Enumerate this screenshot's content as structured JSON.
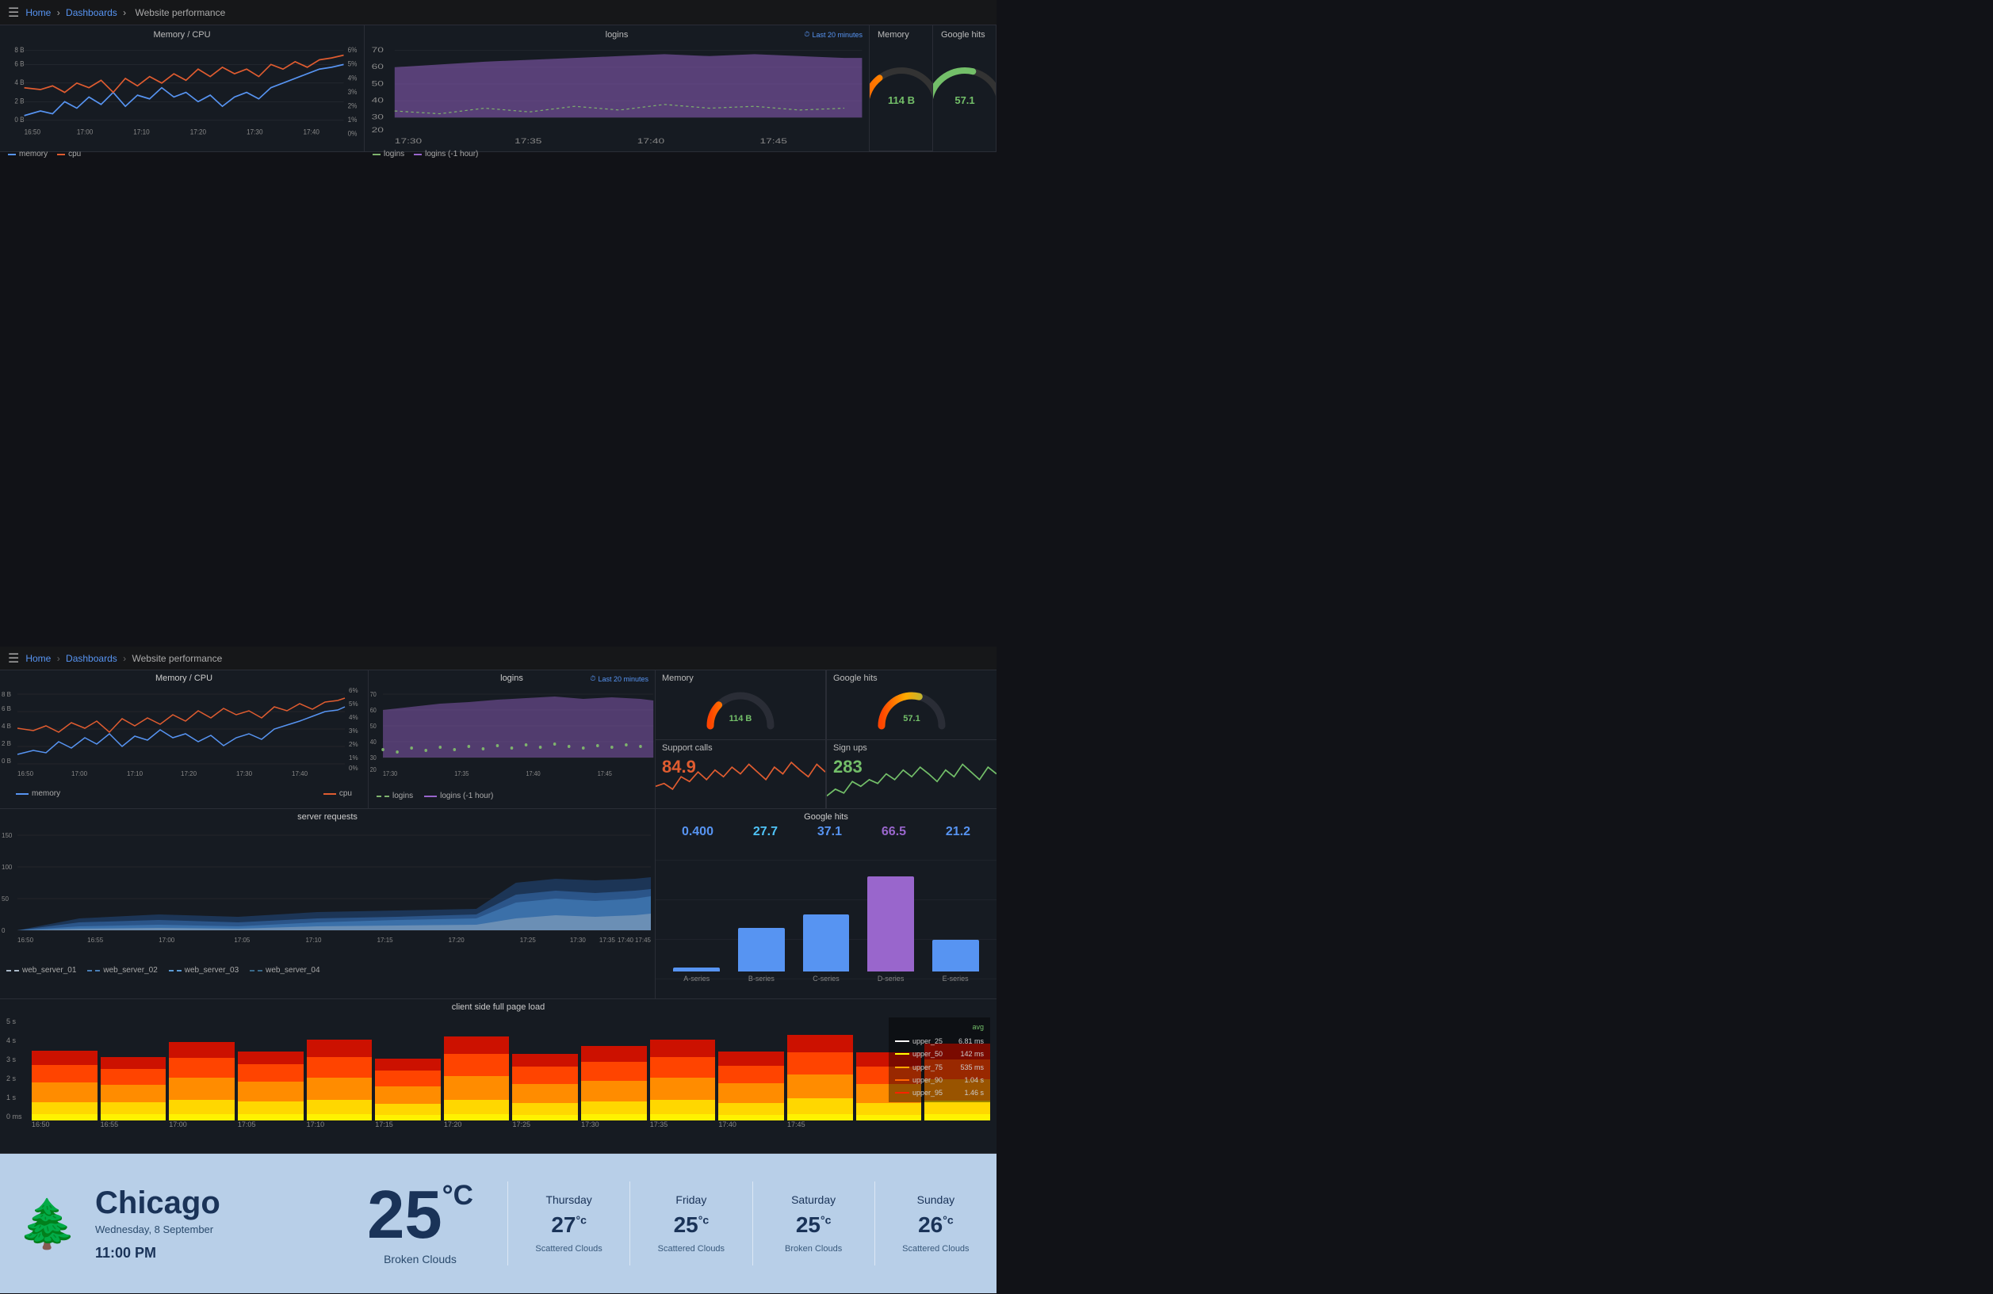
{
  "topbar": {
    "menu_icon": "≡",
    "breadcrumb": [
      {
        "label": "Home",
        "link": true
      },
      {
        "label": "Dashboards",
        "link": true
      },
      {
        "label": "Website performance",
        "link": false
      }
    ]
  },
  "panels": {
    "memory_cpu": {
      "title": "Memory / CPU",
      "legend": [
        {
          "key": "memory",
          "color": "#5794f2",
          "style": "solid"
        },
        {
          "key": "cpu",
          "color": "#e05c30",
          "style": "solid"
        }
      ]
    },
    "logins": {
      "title": "logins",
      "badge": "Last 20 minutes",
      "legend": [
        {
          "key": "logins",
          "color": "#7eb26d"
        },
        {
          "key": "logins (-1 hour)",
          "color": "#9966cc"
        }
      ]
    },
    "memory_stat": {
      "title": "Memory",
      "value": "114 B",
      "value_color": "#73bf69"
    },
    "google_hits_stat": {
      "title": "Google hits",
      "value": "57.1",
      "value_color": "#73bf69"
    },
    "support_calls": {
      "title": "Support calls",
      "value": "84.9",
      "value_color": "#e05c30"
    },
    "sign_ups": {
      "title": "Sign ups",
      "value": "283",
      "value_color": "#73bf69"
    },
    "server_requests": {
      "title": "server requests",
      "legend": [
        {
          "key": "web_server_01",
          "color": "#aaaacc"
        },
        {
          "key": "web_server_02",
          "color": "#4a7eb5"
        },
        {
          "key": "web_server_03",
          "color": "#5b9bd5"
        },
        {
          "key": "web_server_04",
          "color": "#3a6a8a"
        }
      ]
    },
    "google_hits_chart": {
      "title": "Google hits",
      "values": [
        {
          "label": "A-series",
          "value": 0.4,
          "color": "#5794f2",
          "height": 18
        },
        {
          "label": "B-series",
          "value": 27.7,
          "color": "#5794f2",
          "height": 55
        },
        {
          "label": "C-series",
          "value": 37.1,
          "color": "#5794f2",
          "height": 70
        },
        {
          "label": "D-series",
          "value": 66.5,
          "color": "#9966cc",
          "height": 120
        },
        {
          "label": "E-series",
          "value": 21.2,
          "color": "#5794f2",
          "height": 40
        }
      ],
      "value_colors": [
        "#5794f2",
        "#4fc3f7",
        "#5794f2",
        "#9966cc",
        "#5794f2"
      ]
    },
    "client_load": {
      "title": "client side full page load",
      "legend": [
        {
          "key": "upper_25",
          "color": "#fff",
          "avg": "6.81 ms"
        },
        {
          "key": "upper_50",
          "color": "#ffff00",
          "avg": "142 ms"
        },
        {
          "key": "upper_75",
          "color": "#ffa500",
          "avg": "535 ms"
        },
        {
          "key": "upper_90",
          "color": "#ff6600",
          "avg": "1.04 s"
        },
        {
          "key": "upper_95",
          "color": "#ff2200",
          "avg": "1.46 s"
        }
      ],
      "y_labels": [
        "5 s",
        "4 s",
        "3 s",
        "2 s",
        "1 s",
        "0 ms"
      ],
      "x_labels": [
        "16:50",
        "16:55",
        "17:00",
        "17:05",
        "17:10",
        "17:15",
        "17:20",
        "17:25",
        "17:30",
        "17:35",
        "17:40",
        "17:45"
      ]
    }
  },
  "weather": {
    "city": "Chicago",
    "date": "Wednesday, 8 September",
    "time": "11:00 PM",
    "temp": "25",
    "unit": "°C",
    "description": "Broken Clouds",
    "forecasts": [
      {
        "day": "Thursday",
        "temp": "27",
        "unit": "°c",
        "desc": "Scattered Clouds"
      },
      {
        "day": "Friday",
        "temp": "25",
        "unit": "°c",
        "desc": "Scattered Clouds"
      },
      {
        "day": "Saturday",
        "temp": "25",
        "unit": "°c",
        "desc": "Broken Clouds"
      },
      {
        "day": "Sunday",
        "temp": "26",
        "unit": "°c",
        "desc": "Scattered Clouds"
      }
    ]
  }
}
